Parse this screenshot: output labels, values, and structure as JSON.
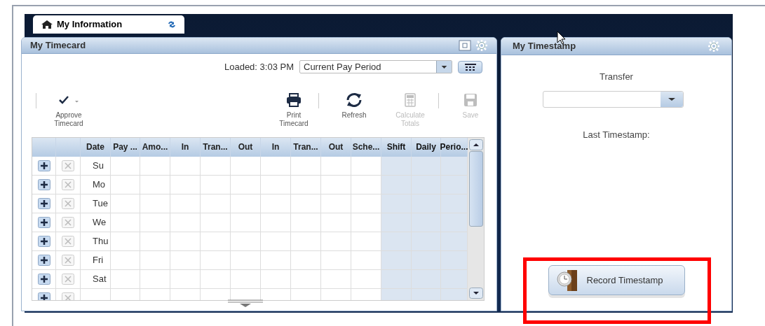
{
  "tabs": [
    {
      "label": "My Information",
      "selected": true
    }
  ],
  "timecard": {
    "title": "My Timecard",
    "loaded": "Loaded: 3:03 PM",
    "period": "Current Pay Period",
    "toolbar": [
      {
        "kind": "approve",
        "label": "Approve Timecard",
        "disabled": false,
        "divider_before": true
      },
      {
        "kind": "print",
        "label": "Print Timecard",
        "disabled": false,
        "divider_before": false
      },
      {
        "kind": "refresh",
        "label": "Refresh",
        "disabled": false,
        "divider_before": true
      },
      {
        "kind": "calculate",
        "label": "Calculate Totals",
        "disabled": true,
        "divider_before": false
      },
      {
        "kind": "save",
        "label": "Save",
        "disabled": true,
        "divider_before": true
      }
    ],
    "columns": [
      {
        "label": "Date",
        "shaded": false
      },
      {
        "label": "Pay ...",
        "shaded": false
      },
      {
        "label": "Amo...",
        "shaded": false
      },
      {
        "label": "In",
        "shaded": false
      },
      {
        "label": "Tran...",
        "shaded": false
      },
      {
        "label": "Out",
        "shaded": false
      },
      {
        "label": "In",
        "shaded": false
      },
      {
        "label": "Tran...",
        "shaded": false
      },
      {
        "label": "Out",
        "shaded": false
      },
      {
        "label": "Sche...",
        "shaded": false
      },
      {
        "label": "Shift",
        "shaded": true
      },
      {
        "label": "Daily",
        "shaded": true
      },
      {
        "label": "Perio...",
        "shaded": true
      }
    ],
    "rows": [
      {
        "date": "Su"
      },
      {
        "date": "Mo"
      },
      {
        "date": "Tue"
      },
      {
        "date": "We"
      },
      {
        "date": "Thu"
      },
      {
        "date": "Fri"
      },
      {
        "date": "Sat"
      },
      {}
    ]
  },
  "timestamp": {
    "title": "My Timestamp",
    "transfer_label": "Transfer",
    "last_label": "Last Timestamp:",
    "button": "Record Timestamp"
  }
}
